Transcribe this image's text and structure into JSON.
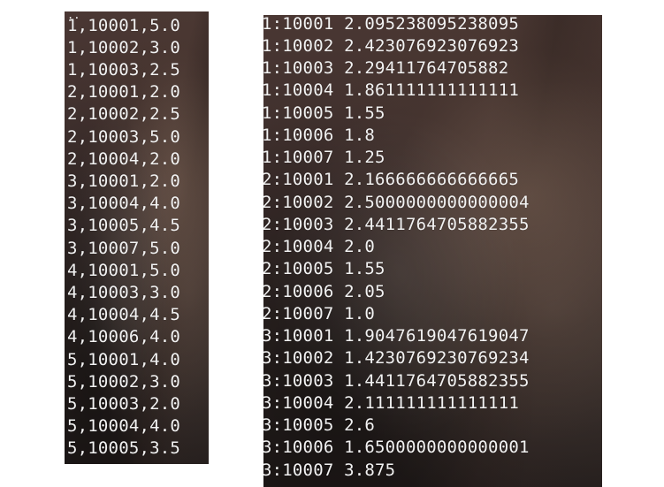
{
  "left_terminal": {
    "partial_top_text": "..",
    "lines": [
      "1,10001,5.0",
      "1,10002,3.0",
      "1,10003,2.5",
      "2,10001,2.0",
      "2,10002,2.5",
      "2,10003,5.0",
      "2,10004,2.0",
      "3,10001,2.0",
      "3,10004,4.0",
      "3,10005,4.5",
      "3,10007,5.0",
      "4,10001,5.0",
      "4,10003,3.0",
      "4,10004,4.5",
      "4,10006,4.0",
      "5,10001,4.0",
      "5,10002,3.0",
      "5,10003,2.0",
      "5,10004,4.0",
      "5,10005,3.5"
    ]
  },
  "right_terminal": {
    "lines": [
      "1:10001 2.095238095238095",
      "1:10002 2.423076923076923",
      "1:10003 2.29411764705882",
      "1:10004 1.861111111111111",
      "1:10005 1.55",
      "1:10006 1.8",
      "1:10007 1.25",
      "2:10001 2.166666666666665",
      "2:10002 2.5000000000000004",
      "2:10003 2.4411764705882355",
      "2:10004 2.0",
      "2:10005 1.55",
      "2:10006 2.05",
      "2:10007 1.0",
      "3:10001 1.9047619047619047",
      "3:10002 1.4230769230769234",
      "3:10003 1.4411764705882355",
      "3:10004 2.111111111111111",
      "3:10005 2.6",
      "3:10006 1.6500000000000001",
      "3:10007 3.875"
    ]
  }
}
